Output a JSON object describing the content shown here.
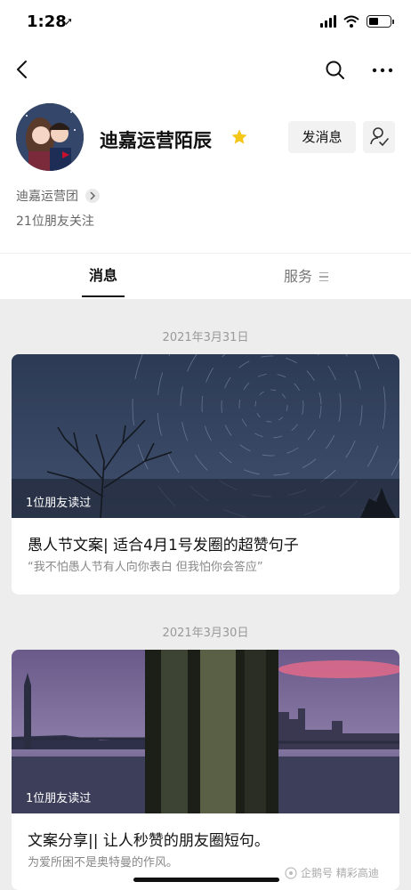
{
  "status_bar": {
    "time": "1:28"
  },
  "profile": {
    "name": "迪嘉运营陌辰",
    "message_button": "发消息",
    "org": "迪嘉运营团",
    "followers": "21位朋友关注"
  },
  "tabs": {
    "messages": "消息",
    "services": "服务"
  },
  "posts": [
    {
      "date": "2021年3月31日",
      "read": "1位朋友读过",
      "title": "愚人节文案| 适合4月1号发圈的超赞句子",
      "quote": "“我不怕愚人节有人向你表白 但我怕你会答应”"
    },
    {
      "date": "2021年3月30日",
      "read": "1位朋友读过",
      "title": "文案分享|| 让人秒赞的朋友圈短句。",
      "quote": "为爱所困不是奥特曼的作风。"
    }
  ],
  "watermark": "企鹅号 精彩高迪",
  "colors": {
    "accent_star": "#f5c518",
    "background": "#ededed"
  },
  "icons": [
    "back-icon",
    "search-icon",
    "more-icon",
    "star-icon",
    "follow-icon",
    "chevron-right-icon",
    "menu-icon"
  ]
}
